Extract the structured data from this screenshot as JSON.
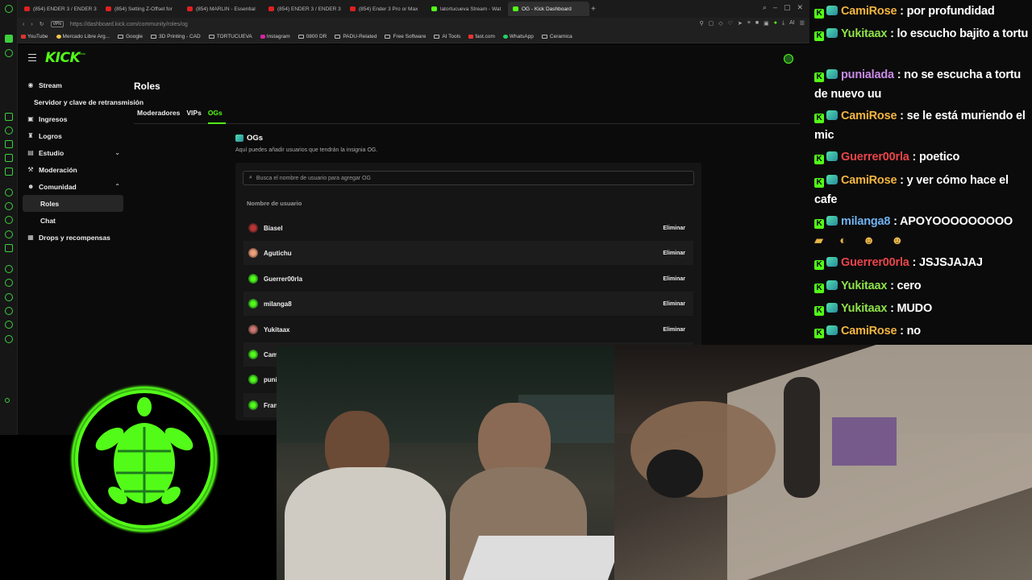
{
  "browser": {
    "tabs": [
      {
        "label": "(854) ENDER 3 / ENDER 3",
        "kind": "youtube"
      },
      {
        "label": "(854) Setting Z-Offset for",
        "kind": "youtube"
      },
      {
        "label": "(854) MARLIN - Essential",
        "kind": "youtube"
      },
      {
        "label": "(854) ENDER 3 / ENDER 3",
        "kind": "youtube"
      },
      {
        "label": "(854) Ender 3 Pro or Max",
        "kind": "youtube"
      },
      {
        "label": "latortucueva Stream - Wat",
        "kind": "kick"
      },
      {
        "label": "OG - Kick Dashboard",
        "kind": "kick-active"
      }
    ],
    "url_badge": "VPN",
    "url": "https://dashboard.kick.com/community/roles/og",
    "url_right_text": "AI",
    "bookmarks": [
      {
        "label": "YouTube",
        "type": "site"
      },
      {
        "label": "Mercado Libre Arg...",
        "type": "site"
      },
      {
        "label": "Google",
        "type": "folder"
      },
      {
        "label": "3D Printing - CAD",
        "type": "folder"
      },
      {
        "label": "TORTUCUEVA",
        "type": "folder"
      },
      {
        "label": "Instagram",
        "type": "site"
      },
      {
        "label": "0800 DR",
        "type": "folder"
      },
      {
        "label": "PADU-Related",
        "type": "folder"
      },
      {
        "label": "Free Software",
        "type": "folder"
      },
      {
        "label": "AI Tools",
        "type": "folder"
      },
      {
        "label": "fast.com",
        "type": "site"
      },
      {
        "label": "WhatsApp",
        "type": "site"
      },
      {
        "label": "Ceramica",
        "type": "folder"
      }
    ]
  },
  "kick": {
    "logo": "KICK",
    "beta": "beta",
    "nav": {
      "stream": "Stream",
      "stream_key": "Servidor y clave de retransmisión",
      "ingresos": "Ingresos",
      "logros": "Logros",
      "estudio": "Estudio",
      "moderacion": "Moderación",
      "comunidad": "Comunidad",
      "roles": "Roles",
      "chat": "Chat",
      "drops": "Drops y recompensas"
    },
    "page_title": "Roles",
    "tabs": {
      "moderadores": "Moderadores",
      "vips": "VIPs",
      "ogs": "OGs"
    },
    "og_title": "OGs",
    "og_desc": "Aquí puedes añadir usuarios que tendrán la insignia OG.",
    "search_placeholder": "Busca el nombre de usuario para agregar OG",
    "col_header": "Nombre de usuario",
    "delete_label": "Eliminar",
    "users": [
      "Biasel",
      "Agutichu",
      "Guerrer00rla",
      "milanga8",
      "Yukitaax",
      "Cam",
      "puni",
      "Fran"
    ]
  },
  "chat": {
    "messages": [
      {
        "user": "CamiRose",
        "text": " : por profundidad",
        "color": "#f4b53f"
      },
      {
        "user": "Yukitaax",
        "text": " : lo escucho bajito a tortu",
        "color": "#8fe04a"
      },
      {
        "user": "punialada",
        "text": " : no se escucha a tortu de nuevo uu",
        "color": "#c98ae8"
      },
      {
        "user": "CamiRose",
        "text": " : se le está muriendo el mic",
        "color": "#f4b53f"
      },
      {
        "user": "Guerrer00rla",
        "text": " : poetico",
        "color": "#e8454a"
      },
      {
        "user": "CamiRose",
        "text": " : y ver cómo hace el cafe",
        "color": "#f4b53f"
      },
      {
        "user": "milanga8",
        "text": " : APOYOOOOOOOOO",
        "color": "#6fb2f0"
      },
      {
        "user": "Guerrer00rla",
        "text": " : JSJSJAJAJ",
        "color": "#e8454a"
      },
      {
        "user": "Yukitaax",
        "text": " : cero",
        "color": "#8fe04a"
      },
      {
        "user": "Yukitaax",
        "text": " : MUDO",
        "color": "#8fe04a"
      },
      {
        "user": "CamiRose",
        "text": " : no",
        "color": "#f4b53f"
      }
    ]
  },
  "colors": {
    "kick_green": "#53fc18",
    "bg": "#0b0b0b"
  }
}
